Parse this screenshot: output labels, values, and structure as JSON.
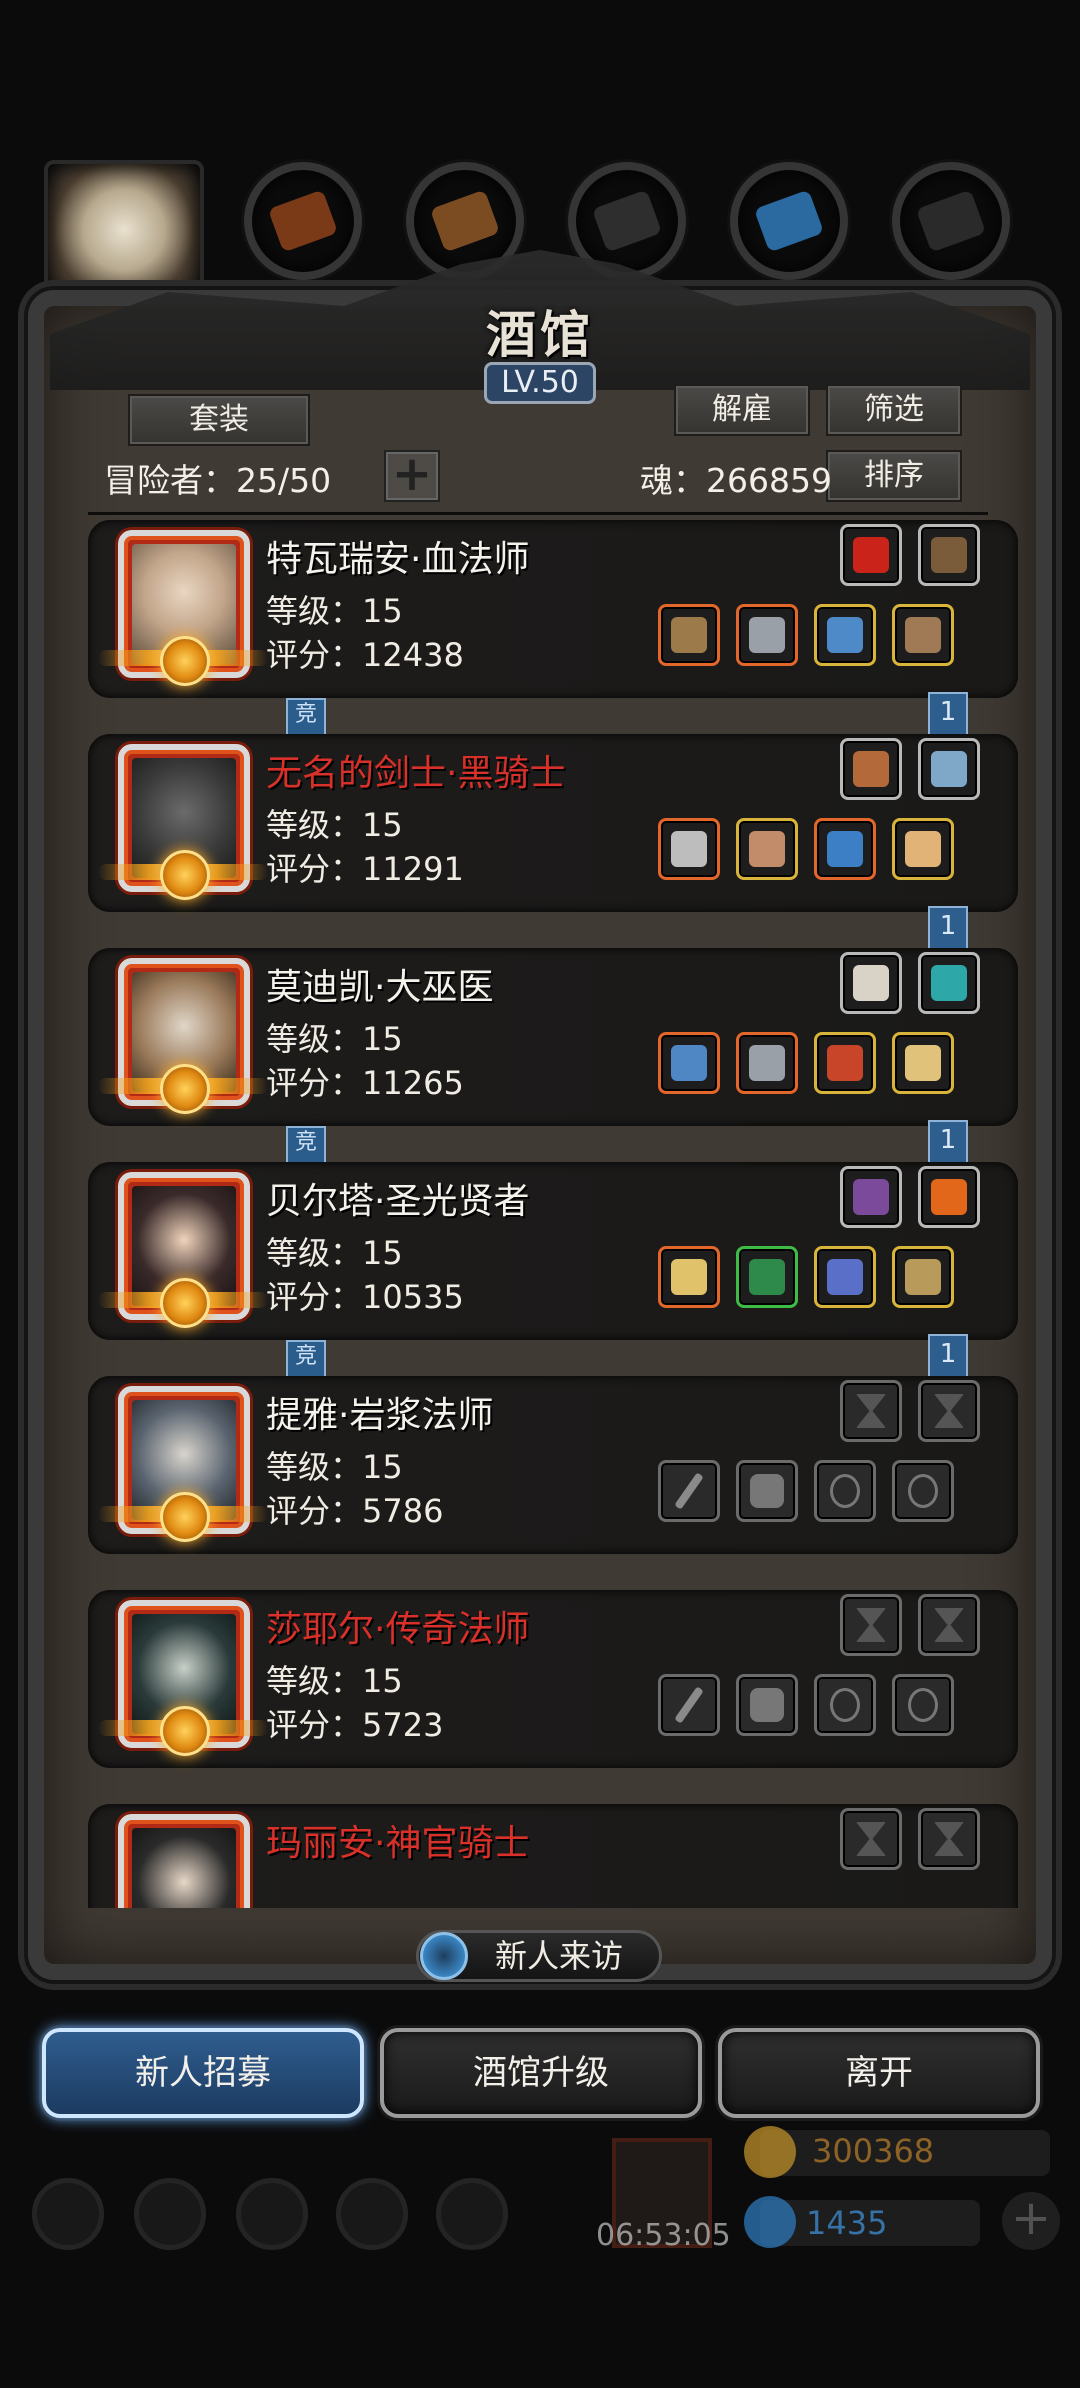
{
  "header": {
    "title": "酒馆",
    "level": "LV.50"
  },
  "toolbar": {
    "set_label": "套装",
    "fire_label": "解雇",
    "filter_label": "筛选",
    "sort_label": "排序",
    "adventurer_label": "冒险者：25/50",
    "soul_label": "魂：266859",
    "plus_label": "+"
  },
  "heroes": [
    {
      "name": "特瓦瑞安·血法师",
      "name_color": "white",
      "level": "等级：15",
      "score": "评分：12438",
      "face": "elf",
      "tag_comp": "竞",
      "tag_count": "1",
      "top_slots": [
        {
          "tier": "gray",
          "icon": "red-gem-icon",
          "color": "#c9231a"
        },
        {
          "tier": "gray",
          "icon": "antler-icon",
          "color": "#7a5b3a"
        }
      ],
      "bottom_slots": [
        {
          "tier": "orange",
          "icon": "staff-icon",
          "color": "#9c7a4a"
        },
        {
          "tier": "orange",
          "icon": "armor-icon",
          "color": "#9aa0a8"
        },
        {
          "tier": "gold",
          "icon": "amulet-icon",
          "color": "#4e89c8"
        },
        {
          "tier": "gold",
          "icon": "skull-ring-icon",
          "color": "#a07a55"
        }
      ]
    },
    {
      "name": "无名的剑士·黑骑士",
      "name_color": "red",
      "level": "等级：15",
      "score": "评分：11291",
      "face": "knight",
      "tag_comp": "",
      "tag_count": "1",
      "top_slots": [
        {
          "tier": "gray",
          "icon": "orb-icon",
          "color": "#b4693a"
        },
        {
          "tier": "gray",
          "icon": "fish-icon",
          "color": "#7fa8c8"
        }
      ],
      "bottom_slots": [
        {
          "tier": "orange",
          "icon": "sword-icon",
          "color": "#bdbdbd"
        },
        {
          "tier": "gold",
          "icon": "demon-armor-icon",
          "color": "#c28c6a"
        },
        {
          "tier": "orange",
          "icon": "blue-gauntlet-icon",
          "color": "#3c7fc4"
        },
        {
          "tier": "gold",
          "icon": "rune-ring-icon",
          "color": "#e2b377"
        }
      ]
    },
    {
      "name": "莫迪凯·大巫医",
      "name_color": "white",
      "level": "等级：15",
      "score": "评分：11265",
      "face": "elder",
      "tag_comp": "竞",
      "tag_count": "1",
      "top_slots": [
        {
          "tier": "gray",
          "icon": "spiked-orb-icon",
          "color": "#d8d2c7"
        },
        {
          "tier": "gray",
          "icon": "teal-gem-icon",
          "color": "#2ea7a8"
        }
      ],
      "bottom_slots": [
        {
          "tier": "orange",
          "icon": "wand-icon",
          "color": "#4f87c4"
        },
        {
          "tier": "orange",
          "icon": "armor-icon",
          "color": "#9aa0a8"
        },
        {
          "tier": "gold",
          "icon": "heart-amulet-icon",
          "color": "#c8452a"
        },
        {
          "tier": "gold",
          "icon": "gold-ring-icon",
          "color": "#e0c27a"
        }
      ]
    },
    {
      "name": "贝尔塔·圣光贤者",
      "name_color": "white",
      "level": "等级：15",
      "score": "评分：10535",
      "face": "sage",
      "tag_comp": "竞",
      "tag_count": "1",
      "top_slots": [
        {
          "tier": "gray",
          "icon": "purple-cube-icon",
          "color": "#7b4a9a"
        },
        {
          "tier": "gray",
          "icon": "fire-orb-icon",
          "color": "#e2671a"
        }
      ],
      "bottom_slots": [
        {
          "tier": "orange",
          "icon": "hammer-icon",
          "color": "#e0c26a"
        },
        {
          "tier": "green",
          "icon": "green-armor-icon",
          "color": "#2e8a4a"
        },
        {
          "tier": "gold",
          "icon": "crystal-icon",
          "color": "#5a70c8"
        },
        {
          "tier": "gold",
          "icon": "scroll-icon",
          "color": "#b89a5a"
        }
      ]
    },
    {
      "name": "提雅·岩浆法师",
      "name_color": "white",
      "level": "等级：15",
      "score": "评分：5786",
      "face": "mage",
      "tag_comp": "",
      "tag_count": "",
      "top_slots": [
        {
          "tier": "empty",
          "icon": "hourglass-icon"
        },
        {
          "tier": "empty",
          "icon": "hourglass-icon"
        }
      ],
      "bottom_slots": [
        {
          "tier": "empty",
          "icon": "wand-slot-icon"
        },
        {
          "tier": "empty",
          "icon": "armor-slot-icon"
        },
        {
          "tier": "empty",
          "icon": "ring-slot-icon"
        },
        {
          "tier": "empty",
          "icon": "ring-slot-icon"
        }
      ]
    },
    {
      "name": "莎耶尔·传奇法师",
      "name_color": "red",
      "level": "等级：15",
      "score": "评分：5723",
      "face": "hooded",
      "tag_comp": "",
      "tag_count": "",
      "top_slots": [
        {
          "tier": "empty",
          "icon": "hourglass-icon"
        },
        {
          "tier": "empty",
          "icon": "hourglass-icon"
        }
      ],
      "bottom_slots": [
        {
          "tier": "empty",
          "icon": "wand-slot-icon"
        },
        {
          "tier": "empty",
          "icon": "armor-slot-icon"
        },
        {
          "tier": "empty",
          "icon": "ring-slot-icon"
        },
        {
          "tier": "empty",
          "icon": "ring-slot-icon"
        }
      ]
    },
    {
      "name": "玛丽安·神官骑士",
      "name_color": "red",
      "level": "",
      "score": "",
      "face": "nun",
      "tag_comp": "",
      "tag_count": "",
      "top_slots": [
        {
          "tier": "empty",
          "icon": "hourglass-icon"
        },
        {
          "tier": "empty",
          "icon": "hourglass-icon"
        }
      ],
      "bottom_slots": []
    }
  ],
  "visit": {
    "label": "新人来访"
  },
  "actions": {
    "recruit": "新人招募",
    "upgrade": "酒馆升级",
    "leave": "离开"
  },
  "footer": {
    "timer": "06:53:05",
    "gold": "300368",
    "gems": "1435",
    "add": "+"
  },
  "colors": {
    "accent_blue": "#2f5d8f",
    "name_red": "#d9302a",
    "panel": "#403a34"
  }
}
